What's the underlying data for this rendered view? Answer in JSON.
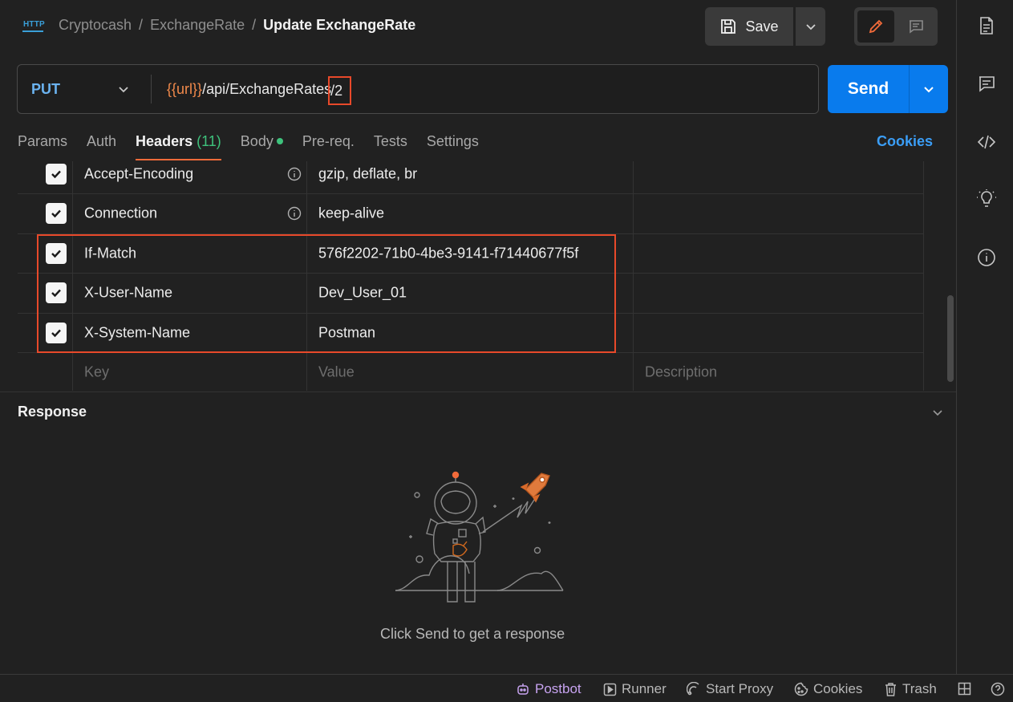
{
  "breadcrumb": {
    "icon": "http-icon",
    "icon_text": "HTTP",
    "items": [
      "Cryptocash",
      "ExchangeRate"
    ],
    "current": "Update ExchangeRate",
    "separator": "/"
  },
  "toolbar": {
    "save_label": "Save"
  },
  "request": {
    "method": "PUT",
    "url_variable": "{{url}}",
    "url_path": "/api/ExchangeRates",
    "url_highlight": "/2",
    "send_label": "Send"
  },
  "tabs": {
    "params": "Params",
    "auth": "Auth",
    "headers": "Headers",
    "headers_count": "(11)",
    "body": "Body",
    "prereq": "Pre-req.",
    "tests": "Tests",
    "settings": "Settings",
    "cookies": "Cookies"
  },
  "headers": {
    "rows": [
      {
        "key": "Accept-Encoding",
        "value": "gzip, deflate, br",
        "checked": true
      },
      {
        "key": "Connection",
        "value": "keep-alive",
        "checked": true
      },
      {
        "key": "If-Match",
        "value": "576f2202-71b0-4be3-9141-f71440677f5f",
        "checked": true
      },
      {
        "key": "X-User-Name",
        "value": "Dev_User_01",
        "checked": true
      },
      {
        "key": "X-System-Name",
        "value": "Postman",
        "checked": true
      }
    ],
    "placeholder": {
      "key": "Key",
      "value": "Value",
      "description": "Description"
    }
  },
  "response": {
    "title": "Response",
    "hint": "Click Send to get a response"
  },
  "statusbar": {
    "postbot": "Postbot",
    "runner": "Runner",
    "start_proxy": "Start Proxy",
    "cookies": "Cookies",
    "trash": "Trash"
  },
  "colors": {
    "accent": "#f26b3a",
    "send": "#097bed",
    "highlight": "#e8492a",
    "method": "#6bb3f0",
    "success": "#3ec27c",
    "postbot": "#c7a3f0"
  }
}
